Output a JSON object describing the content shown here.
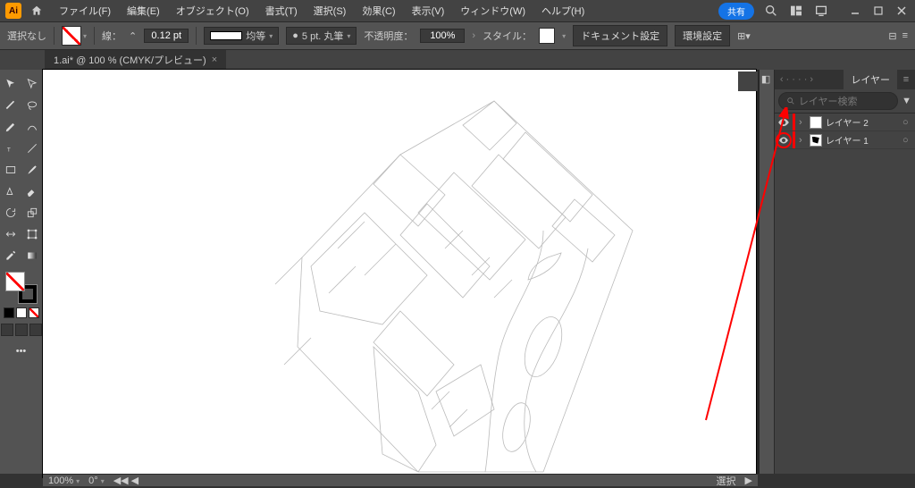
{
  "app": {
    "icon_text": "Ai"
  },
  "menu": {
    "file": "ファイル(F)",
    "edit": "編集(E)",
    "object": "オブジェクト(O)",
    "type": "書式(T)",
    "select": "選択(S)",
    "effect": "効果(C)",
    "view": "表示(V)",
    "window": "ウィンドウ(W)",
    "help": "ヘルプ(H)"
  },
  "header": {
    "share": "共有"
  },
  "options": {
    "selection": "選択なし",
    "stroke_label": "線：",
    "stroke_width": "0.12 pt",
    "dash_label": "均等",
    "brush_label": "5 pt. 丸筆",
    "opacity_label": "不透明度：",
    "opacity_value": "100%",
    "style_label": "スタイル：",
    "doc_setup": "ドキュメント設定",
    "prefs": "環境設定"
  },
  "doc": {
    "tab": "1.ai* @ 100 % (CMYK/プレビュー)"
  },
  "layers_panel": {
    "title": "レイヤー",
    "search_placeholder": "レイヤー検索",
    "items": [
      {
        "name": "レイヤー 2"
      },
      {
        "name": "レイヤー 1"
      }
    ]
  },
  "status": {
    "zoom": "100%",
    "rotate": "0°",
    "tool": "選択"
  }
}
